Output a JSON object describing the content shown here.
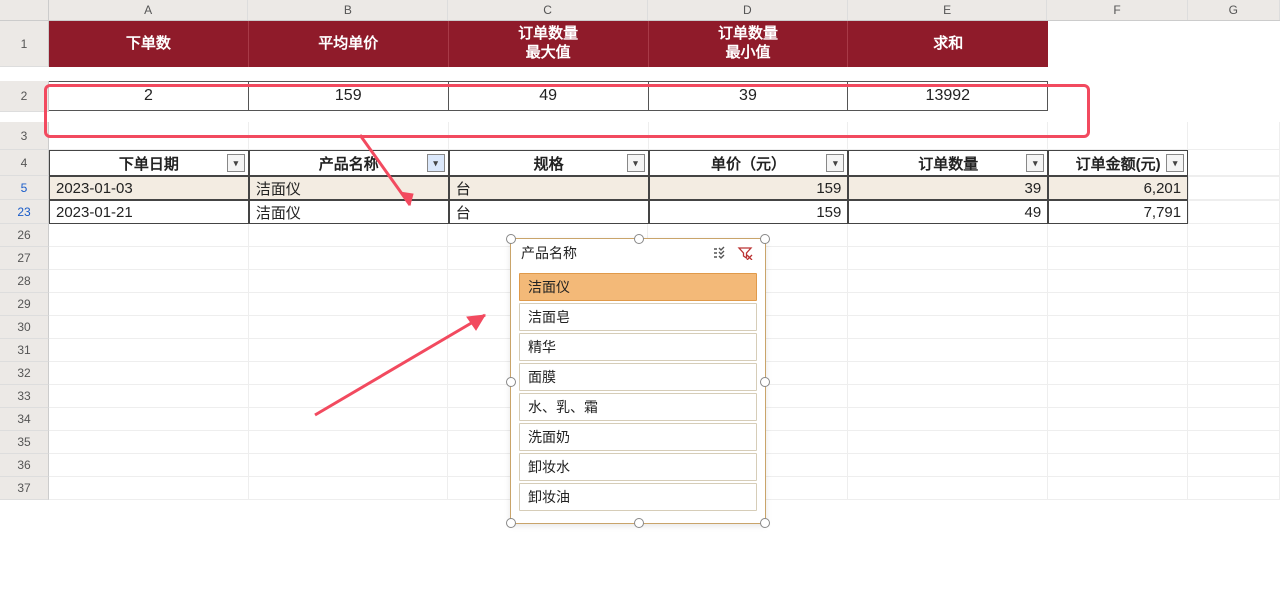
{
  "columns": [
    "A",
    "B",
    "C",
    "D",
    "E",
    "F",
    "G"
  ],
  "summary_header": {
    "A": "下单数",
    "B": "平均单价",
    "C": "订单数量\n最大值",
    "D": "订单数量\n最小值",
    "E": "求和"
  },
  "summary_values": {
    "A": "2",
    "B": "159",
    "C": "49",
    "D": "39",
    "E": "13992"
  },
  "table_header": {
    "A": "下单日期",
    "B": "产品名称",
    "C": "规格",
    "D": "单价（元）",
    "E": "订单数量",
    "F": "订单金额(元)"
  },
  "data_rows": [
    {
      "rownum": "5",
      "date": "2023-01-03",
      "prod": "洁面仪",
      "spec": "台",
      "price": "159",
      "qty": "39",
      "amt": "6,201",
      "alt": true
    },
    {
      "rownum": "23",
      "date": "2023-01-21",
      "prod": "洁面仪",
      "spec": "台",
      "price": "159",
      "qty": "49",
      "amt": "7,791",
      "alt": false
    }
  ],
  "row_numbers_visible": [
    "1",
    "2",
    "3",
    "4",
    "5",
    "23",
    "26",
    "27",
    "28",
    "29",
    "30",
    "31",
    "32",
    "33",
    "34",
    "35",
    "36",
    "37"
  ],
  "slicer": {
    "title": "产品名称",
    "items": [
      "洁面仪",
      "洁面皂",
      "精华",
      "面膜",
      "水、乳、霜",
      "洗面奶",
      "卸妆水",
      "卸妆油"
    ],
    "selected": "洁面仪"
  },
  "chart_data": {
    "type": "table",
    "title": "Filtered order rows for product = 洁面仪 with summary aggregates",
    "summary": {
      "下单数": 2,
      "平均单价": 159,
      "订单数量最大值": 49,
      "订单数量最小值": 39,
      "求和": 13992
    },
    "columns": [
      "下单日期",
      "产品名称",
      "规格",
      "单价（元）",
      "订单数量",
      "订单金额(元)"
    ],
    "rows": [
      [
        "2023-01-03",
        "洁面仪",
        "台",
        159,
        39,
        6201
      ],
      [
        "2023-01-21",
        "洁面仪",
        "台",
        159,
        49,
        7791
      ]
    ],
    "slicer_options": [
      "洁面仪",
      "洁面皂",
      "精华",
      "面膜",
      "水、乳、霜",
      "洗面奶",
      "卸妆水",
      "卸妆油"
    ]
  }
}
